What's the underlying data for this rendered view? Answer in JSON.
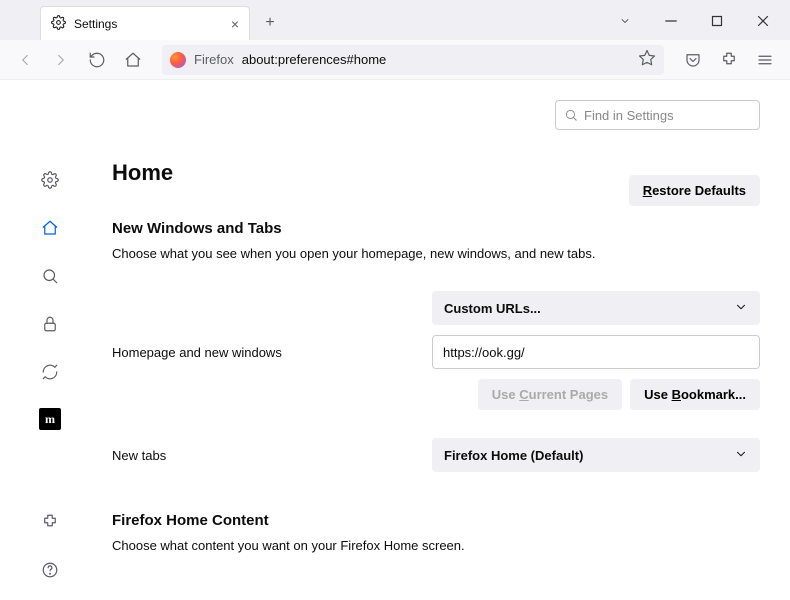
{
  "tab": {
    "title": "Settings"
  },
  "urlbar": {
    "brand": "Firefox",
    "url": "about:preferences#home"
  },
  "search": {
    "placeholder": "Find in Settings"
  },
  "page": {
    "title": "Home",
    "restore": "estore Defaults",
    "restore_prefix": "R"
  },
  "section1": {
    "heading": "New Windows and Tabs",
    "desc": "Choose what you see when you open your homepage, new windows, and new tabs.",
    "homepage_select": "Custom URLs...",
    "homepage_label": "Homepage and new windows",
    "homepage_value": "https://ook.gg/",
    "use_current_prefix": "Use ",
    "use_current": "C",
    "use_current_suffix": "urrent Pages",
    "use_bookmark_prefix": "Use ",
    "use_bookmark": "B",
    "use_bookmark_suffix": "ookmark...",
    "newtabs_label": "New tabs",
    "newtabs_select": "Firefox Home (Default)"
  },
  "section2": {
    "heading": "Firefox Home Content",
    "desc": "Choose what content you want on your Firefox Home screen."
  }
}
